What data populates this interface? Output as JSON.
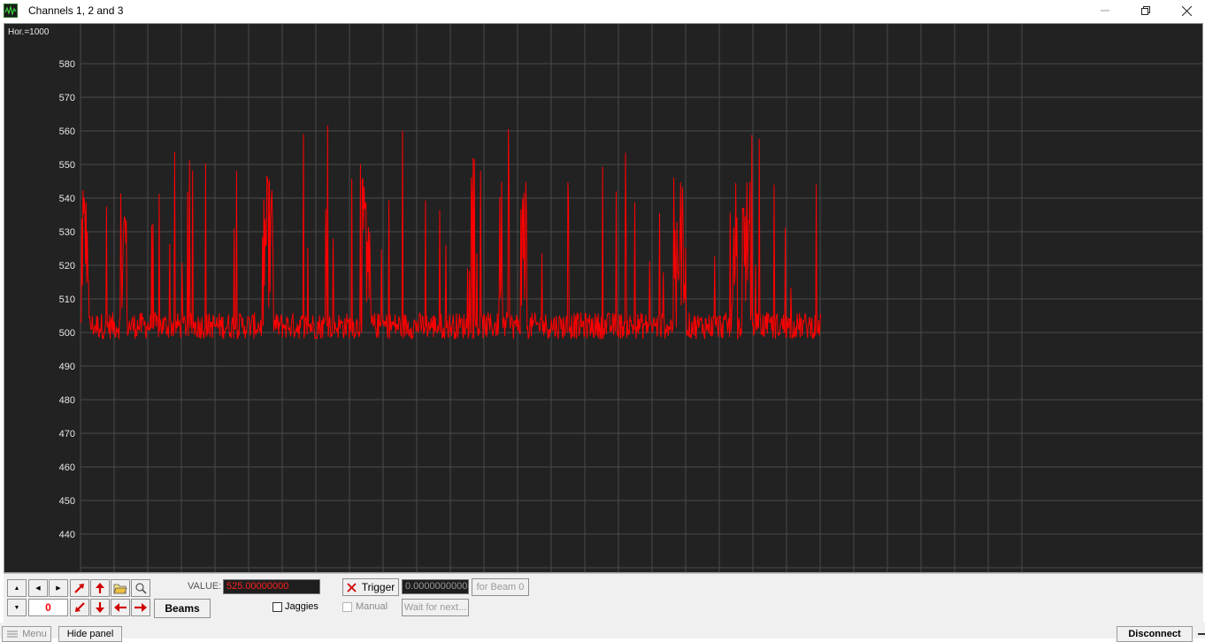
{
  "window": {
    "title": "Channels 1, 2 and 3",
    "icons": {
      "app": "oscilloscope-icon",
      "minimize": "minimize-icon",
      "maximize": "restore-icon",
      "close": "close-icon"
    }
  },
  "plot": {
    "hor_label": "Hor.=1000",
    "background": "#222222",
    "grid_color": "#4a4a4a",
    "trace_color": "#ff0000"
  },
  "chart_data": {
    "type": "line",
    "xlabel": "",
    "ylabel": "",
    "ylim": [
      434,
      588
    ],
    "y_ticks": [
      580,
      570,
      560,
      550,
      540,
      530,
      520,
      510,
      500,
      490,
      480,
      470,
      460,
      450,
      440
    ],
    "grid": true,
    "series": [
      {
        "color": "#ff0000",
        "y_baseline": 502,
        "y_min": 496,
        "y_max": 562,
        "x_fraction_end": 0.66
      }
    ]
  },
  "panel": {
    "value_label": "VALUE:",
    "value": "525.00000000",
    "counter": "0",
    "beams_label": "Beams",
    "jaggies_label": "Jaggies",
    "trigger_label": "Trigger",
    "trigger_value": "0.0000000000",
    "for_beam_label": "for Beam 0",
    "manual_label": "Manual",
    "wait_label": "Wait for next...",
    "value_color": "#ff2020",
    "icons": {
      "up": "up-small-icon",
      "down": "down-small-icon",
      "left": "left-small-icon",
      "right": "right-small-icon",
      "arrow_ne": "diagonal-up-right-arrow-icon",
      "arrow_up": "arrow-up-icon",
      "open": "open-folder-icon",
      "zoom": "magnifier-icon",
      "arrow_sw": "diagonal-down-left-arrow-icon",
      "arrow_down": "arrow-down-icon",
      "arrow_left": "arrow-left-icon",
      "arrow_right": "arrow-right-icon",
      "trigger": "x-icon"
    }
  },
  "statusbar": {
    "menu_label": "Menu",
    "hide_panel_label": "Hide panel",
    "disconnect_label": "Disconnect"
  }
}
